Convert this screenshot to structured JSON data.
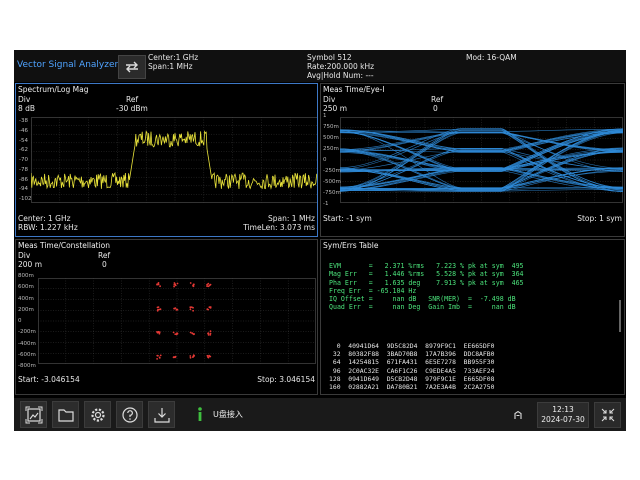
{
  "app": {
    "title": "Vector Signal Analyzer"
  },
  "header": {
    "center": "Center:1 GHz",
    "span": "Span:1 MHz",
    "symbol": "Symbol 512",
    "rate": "Rate:200.000 kHz",
    "avg": "Avg|Hold Num: ---",
    "mod": "Mod: 16-QAM"
  },
  "spectrum": {
    "title": "Spectrum/Log Mag",
    "div_label": "Div",
    "div_value": "8 dB",
    "ref_label": "Ref",
    "ref_value": "-30 dBm",
    "y_ticks": [
      "-38",
      "-46",
      "-54",
      "-62",
      "-70",
      "-78",
      "-86",
      "-94",
      "-102"
    ],
    "center": "Center: 1 GHz",
    "span": "Span: 1 MHz",
    "rbw": "RBW: 1.227 kHz",
    "timelen": "TimeLen: 3.073 ms",
    "trace_color": "#e8e23a"
  },
  "eye": {
    "title": "Meas Time/Eye-I",
    "div_label": "Div",
    "div_value": "250 m",
    "ref_label": "Ref",
    "ref_value": "0",
    "y_ticks": [
      "1",
      "750m",
      "500m",
      "250m",
      "0",
      "-250m",
      "-500m",
      "-750m",
      "-1"
    ],
    "start": "Start: -1  sym",
    "stop": "Stop: 1  sym",
    "trace_color": "#2f8bd8"
  },
  "constellation": {
    "title": "Meas Time/Constellation",
    "div_label": "Div",
    "div_value": "200 m",
    "ref_label": "Ref",
    "ref_value": "0",
    "y_ticks": [
      "800m",
      "600m",
      "400m",
      "200m",
      "0",
      "-200m",
      "-400m",
      "-600m",
      "-800m"
    ],
    "start": "Start: -3.046154",
    "stop": "Stop: 3.046154",
    "point_color": "#e53935"
  },
  "symerr": {
    "title": "Sym/Errs Table",
    "lines": [
      "EVM       =   2.371 %rms   7.223 % pk at sym  495",
      "Mag Err   =   1.446 %rms   5.528 % pk at sym  364",
      "Pha Err   =   1.635 deg    7.913 % pk at sym  465",
      "Freq Err  = -65.104 Hz",
      "IQ Offset =     nan dB   SNR(MER)  =  -7.498 dB",
      "Quad Err  =     nan Deg  Gain Imb  =     nan dB"
    ],
    "hex_lines": [
      "  0  40941D64  9D5C82D4  8979F9C1  EE665DF0",
      " 32  80382F88  3BAD70B8  17A7B396  DDC8AFB0",
      " 64  14254815  671FA431  6E5E7278  BB955F30",
      " 96  2C0AC32E  CA6F1C26  C9EDE4A5  733AEF24",
      "128  0941D649  D5CB2D48  979F9C1E  E665DF08",
      "160  02882A21  DA780B21  7A2E3A4B  2C2A2750"
    ]
  },
  "bottom": {
    "icons": [
      "screenshot-icon",
      "folder-icon",
      "settings-icon",
      "help-icon",
      "save-icon"
    ],
    "notice": "U盘接入",
    "time": "12:13",
    "date": "2024-07-30"
  }
}
